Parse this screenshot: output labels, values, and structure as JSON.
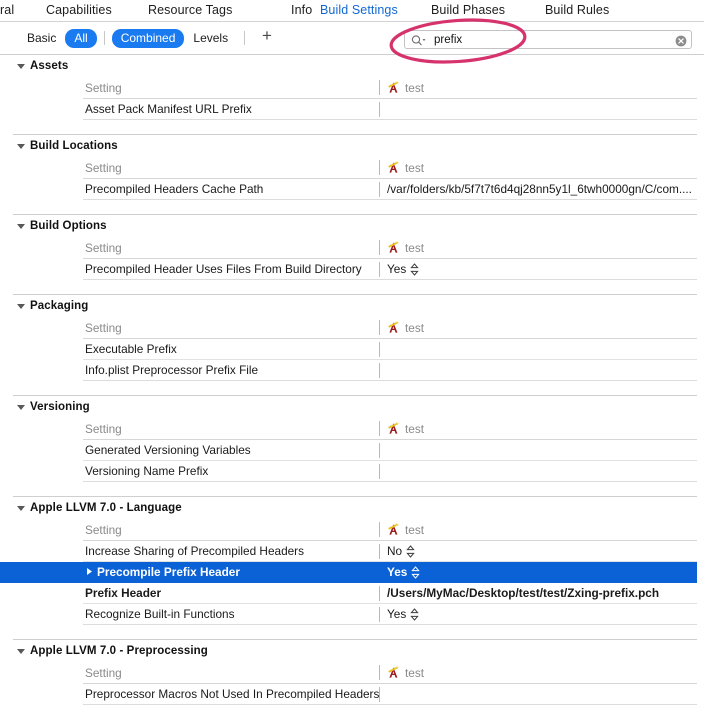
{
  "window": {
    "title": "Xcode Build Settings"
  },
  "editor_tabs": {
    "items": [
      {
        "label": "ral",
        "active": false,
        "name": "tab-general"
      },
      {
        "label": "Capabilities",
        "active": false,
        "name": "tab-capabilities"
      },
      {
        "label": "Resource Tags",
        "active": false,
        "name": "tab-resource-tags"
      },
      {
        "label": "Info",
        "active": false,
        "name": "tab-info"
      },
      {
        "label": "Build Settings",
        "active": true,
        "name": "tab-build-settings"
      },
      {
        "label": "Build Phases",
        "active": false,
        "name": "tab-build-phases"
      },
      {
        "label": "Build Rules",
        "active": false,
        "name": "tab-build-rules"
      }
    ],
    "active_color": "#1268d3"
  },
  "filter_bar": {
    "segments": [
      {
        "label": "Basic",
        "selected": false,
        "name": "filter-basic"
      },
      {
        "label": "All",
        "selected": true,
        "name": "filter-all"
      },
      {
        "label": "Combined",
        "selected": true,
        "name": "filter-combined"
      },
      {
        "label": "Levels",
        "selected": false,
        "name": "filter-levels"
      }
    ],
    "add_button_label": "+",
    "selected_color": "#1a7bf0"
  },
  "search": {
    "value": "prefix",
    "placeholder": "",
    "icon": "search-icon",
    "clear_icon": "clear-icon"
  },
  "annotation": {
    "shape": "ellipse",
    "color": "#d6336c",
    "target": "search-field"
  },
  "columns": {
    "setting": "Setting",
    "target": "test"
  },
  "sections": [
    {
      "title": "Assets",
      "expanded": true,
      "rows": [
        {
          "name": "Asset Pack Manifest URL Prefix",
          "value": "",
          "bold": false,
          "stepper": false,
          "selected": false,
          "disclosure": false
        }
      ]
    },
    {
      "title": "Build Locations",
      "expanded": true,
      "rows": [
        {
          "name": "Precompiled Headers Cache Path",
          "value": "/var/folders/kb/5f7t7t6d4qj28nn5y1l_6twh0000gn/C/com....",
          "bold": false,
          "stepper": false,
          "selected": false,
          "disclosure": false
        }
      ]
    },
    {
      "title": "Build Options",
      "expanded": true,
      "rows": [
        {
          "name": "Precompiled Header Uses Files From Build Directory",
          "value": "Yes",
          "bold": false,
          "stepper": true,
          "selected": false,
          "disclosure": false
        }
      ]
    },
    {
      "title": "Packaging",
      "expanded": true,
      "rows": [
        {
          "name": "Executable Prefix",
          "value": "",
          "bold": false,
          "stepper": false,
          "selected": false,
          "disclosure": false
        },
        {
          "name": "Info.plist Preprocessor Prefix File",
          "value": "",
          "bold": false,
          "stepper": false,
          "selected": false,
          "disclosure": false
        }
      ]
    },
    {
      "title": "Versioning",
      "expanded": true,
      "rows": [
        {
          "name": "Generated Versioning Variables",
          "value": "",
          "bold": false,
          "stepper": false,
          "selected": false,
          "disclosure": false
        },
        {
          "name": "Versioning Name Prefix",
          "value": "",
          "bold": false,
          "stepper": false,
          "selected": false,
          "disclosure": false
        }
      ]
    },
    {
      "title": "Apple LLVM 7.0 - Language",
      "expanded": true,
      "rows": [
        {
          "name": "Increase Sharing of Precompiled Headers",
          "value": "No",
          "bold": false,
          "stepper": true,
          "selected": false,
          "disclosure": false
        },
        {
          "name": "Precompile Prefix Header",
          "value": "Yes",
          "bold": true,
          "stepper": true,
          "selected": true,
          "disclosure": true
        },
        {
          "name": "Prefix Header",
          "value": "/Users/MyMac/Desktop/test/test/Zxing-prefix.pch",
          "bold": true,
          "stepper": false,
          "selected": false,
          "disclosure": false
        },
        {
          "name": "Recognize Built-in Functions",
          "value": "Yes",
          "bold": false,
          "stepper": true,
          "selected": false,
          "disclosure": false
        }
      ]
    },
    {
      "title": "Apple LLVM 7.0 - Preprocessing",
      "expanded": true,
      "rows": [
        {
          "name": "Preprocessor Macros Not Used In Precompiled Headers",
          "value": "",
          "bold": false,
          "stepper": false,
          "selected": false,
          "disclosure": false
        }
      ]
    }
  ],
  "scrollbar": {
    "orientation": "vertical",
    "position": "left"
  }
}
